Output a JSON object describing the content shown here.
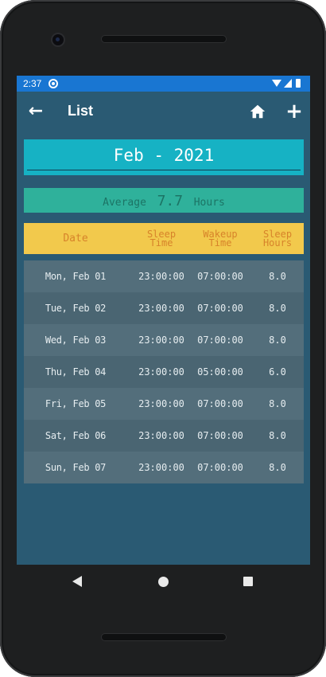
{
  "status_bar": {
    "time": "2:37"
  },
  "app_bar": {
    "title": "List",
    "back_icon": "←",
    "add_icon": "+"
  },
  "month": {
    "label": "Feb - 2021"
  },
  "average": {
    "label": "Average",
    "value": "7.7",
    "unit": "Hours"
  },
  "table": {
    "headers": {
      "date": "Date",
      "sleep_line1": "Sleep",
      "sleep_line2": "Time",
      "wake_line1": "Wakeup",
      "wake_line2": "Time",
      "hours_line1": "Sleep",
      "hours_line2": "Hours"
    },
    "rows": [
      {
        "date": "Mon, Feb 01",
        "sleep": "23:00:00",
        "wake": "07:00:00",
        "hours": "8.0"
      },
      {
        "date": "Tue, Feb 02",
        "sleep": "23:00:00",
        "wake": "07:00:00",
        "hours": "8.0"
      },
      {
        "date": "Wed, Feb 03",
        "sleep": "23:00:00",
        "wake": "07:00:00",
        "hours": "8.0"
      },
      {
        "date": "Thu, Feb 04",
        "sleep": "23:00:00",
        "wake": "05:00:00",
        "hours": "6.0"
      },
      {
        "date": "Fri, Feb 05",
        "sleep": "23:00:00",
        "wake": "07:00:00",
        "hours": "8.0"
      },
      {
        "date": "Sat, Feb 06",
        "sleep": "23:00:00",
        "wake": "07:00:00",
        "hours": "8.0"
      },
      {
        "date": "Sun, Feb 07",
        "sleep": "23:00:00",
        "wake": "07:00:00",
        "hours": "8.0"
      }
    ]
  },
  "colors": {
    "screen_bg": "#2a5a73",
    "status_bar": "#1976d2",
    "month_box": "#16b2c4",
    "average_box": "#2fb19b",
    "header_bg": "#f2c94c",
    "header_text": "#d7832a",
    "row_dark": "#4a6572",
    "row_light": "#536e7b"
  },
  "icons": {
    "back": "back-arrow-icon",
    "home": "home-icon",
    "add": "plus-icon",
    "nav_back": "nav-back-icon",
    "nav_home": "nav-home-icon",
    "nav_recents": "nav-recents-icon"
  }
}
